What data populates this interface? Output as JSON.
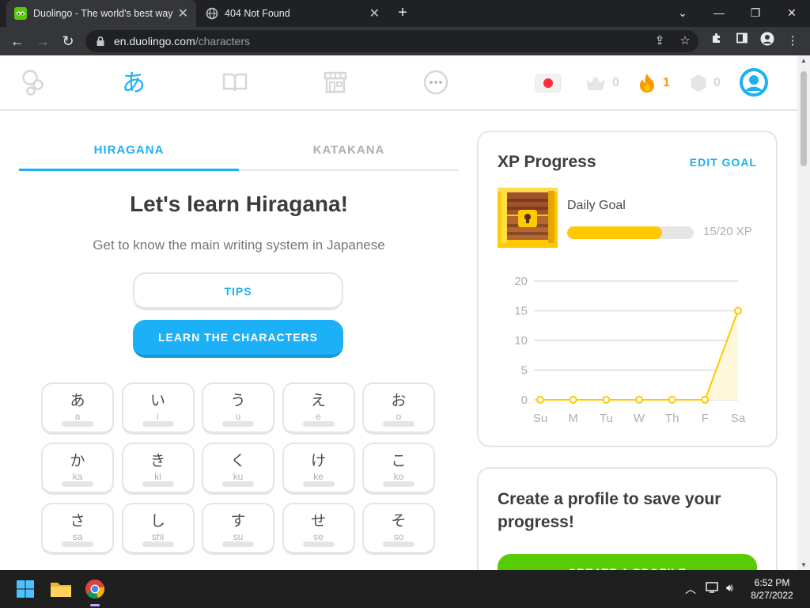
{
  "browser": {
    "tabs": [
      {
        "title": "Duolingo - The world's best way",
        "active": true
      },
      {
        "title": "404 Not Found",
        "active": false
      }
    ],
    "url": {
      "host": "en.duolingo.com",
      "path": "/characters"
    }
  },
  "nav": {
    "stats": {
      "crowns": "0",
      "streak": "1",
      "gems": "0"
    },
    "colors": {
      "active": "#1cb0f6",
      "streak": "#ff9600",
      "inactive": "#e5e5e5"
    }
  },
  "kana_tabs": {
    "hiragana": "HIRAGANA",
    "katakana": "KATAKANA"
  },
  "main": {
    "heading": "Let's learn Hiragana!",
    "subheading": "Get to know the main writing system in Japanese",
    "tips_label": "TIPS",
    "learn_label": "LEARN THE CHARACTERS"
  },
  "characters": [
    {
      "kana": "あ",
      "romaji": "a"
    },
    {
      "kana": "い",
      "romaji": "i"
    },
    {
      "kana": "う",
      "romaji": "u"
    },
    {
      "kana": "え",
      "romaji": "e"
    },
    {
      "kana": "お",
      "romaji": "o"
    },
    {
      "kana": "か",
      "romaji": "ka"
    },
    {
      "kana": "き",
      "romaji": "ki"
    },
    {
      "kana": "く",
      "romaji": "ku"
    },
    {
      "kana": "け",
      "romaji": "ke"
    },
    {
      "kana": "こ",
      "romaji": "ko"
    },
    {
      "kana": "さ",
      "romaji": "sa"
    },
    {
      "kana": "し",
      "romaji": "shi"
    },
    {
      "kana": "す",
      "romaji": "su"
    },
    {
      "kana": "せ",
      "romaji": "se"
    },
    {
      "kana": "そ",
      "romaji": "so"
    }
  ],
  "xp": {
    "title": "XP Progress",
    "edit_goal": "EDIT GOAL",
    "daily_goal_label": "Daily Goal",
    "progress_text": "15/20 XP",
    "progress_fraction": 0.75
  },
  "chart_data": {
    "type": "line",
    "categories": [
      "Su",
      "M",
      "Tu",
      "W",
      "Th",
      "F",
      "Sa"
    ],
    "values": [
      0,
      0,
      0,
      0,
      0,
      0,
      15
    ],
    "ylim": [
      0,
      20
    ],
    "yticks": [
      0,
      5,
      10,
      15,
      20
    ],
    "grid": true,
    "color": "#ffc800"
  },
  "profile": {
    "title": "Create a profile to save your progress!",
    "button": "CREATE A PROFILE"
  },
  "taskbar": {
    "time": "6:52 PM",
    "date": "8/27/2022"
  }
}
